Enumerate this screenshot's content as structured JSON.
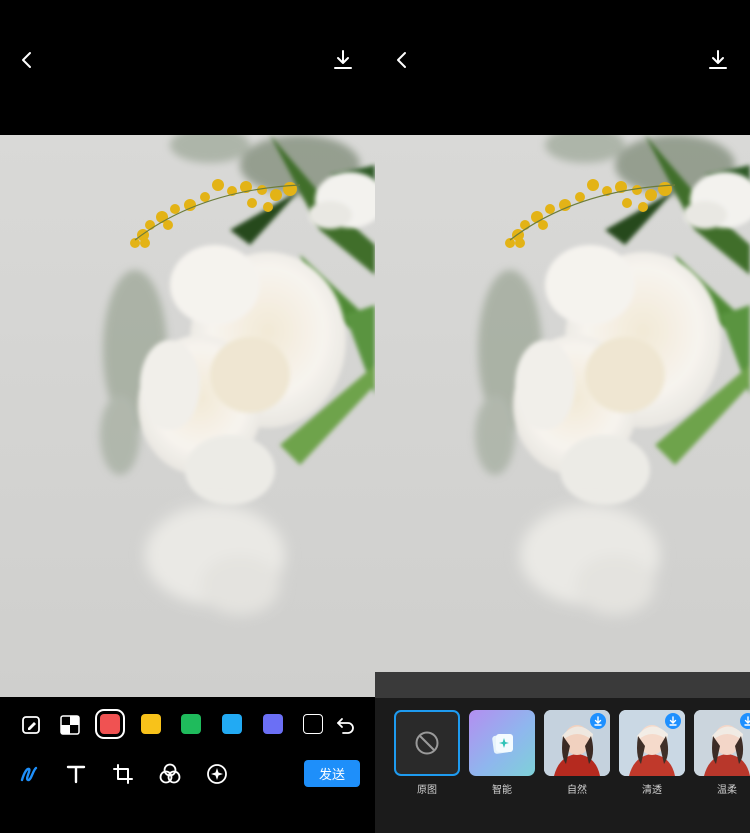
{
  "colors": {
    "accent": "#1e8ffa",
    "swatches": [
      "#000000",
      "#f05252",
      "#f8c21a",
      "#1fbb5c",
      "#22aaf3",
      "#6b6ff5",
      "#000000"
    ]
  },
  "left_panel": {
    "icons": {
      "back": "chevron-left-icon",
      "download": "download-icon",
      "pen": "edit-pen-icon",
      "mosaic": "mosaic-icon",
      "undo": "undo-icon",
      "brush": "brush-stroke-icon",
      "text": "text-icon",
      "crop": "crop-icon",
      "effect": "color-circles-icon",
      "sticker": "sticker-icon"
    },
    "send_label": "发送"
  },
  "right_panel": {
    "filters": [
      {
        "label": "原图",
        "selected": true,
        "icon": "no-filter-icon"
      },
      {
        "label": "智能",
        "selected": false,
        "icon": "smart-sparkle-icon"
      },
      {
        "label": "自然",
        "selected": false,
        "downloadable": true
      },
      {
        "label": "清透",
        "selected": false,
        "downloadable": true
      },
      {
        "label": "温柔",
        "selected": false,
        "downloadable": true
      }
    ]
  }
}
